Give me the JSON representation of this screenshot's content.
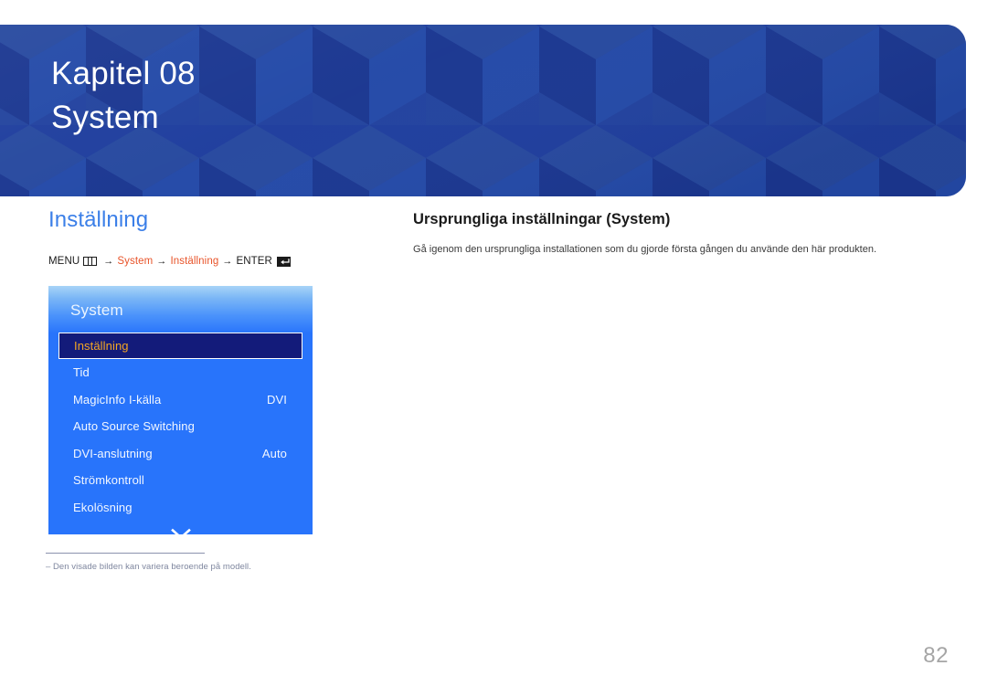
{
  "header": {
    "chapter_label": "Kapitel 08",
    "chapter_title": "System",
    "background_color": "#1f3e9e",
    "text_color": "#ffffff"
  },
  "left": {
    "section_heading": "Inställning",
    "section_heading_color": "#3b7fe8",
    "breadcrumb": {
      "menu_label": "MENU",
      "menu_icon": "menu-grid-icon",
      "arrow_1": "→",
      "crumb_1": "System",
      "arrow_2": "→",
      "crumb_2": "Inställning",
      "arrow_3": "→",
      "enter_label": "ENTER",
      "enter_icon": "enter-return-icon",
      "crumb_color": "#e8542a"
    },
    "osd": {
      "title": "System",
      "panel_color": "#2874fb",
      "selected_row_color": "#131b7a",
      "selected_text_color": "#f5a623",
      "items": [
        {
          "label": "Inställning",
          "value": "",
          "selected": true
        },
        {
          "label": "Tid",
          "value": "",
          "selected": false
        },
        {
          "label": "MagicInfo I-källa",
          "value": "DVI",
          "selected": false
        },
        {
          "label": "Auto Source Switching",
          "value": "",
          "selected": false
        },
        {
          "label": "DVI-anslutning",
          "value": "Auto",
          "selected": false
        },
        {
          "label": "Strömkontroll",
          "value": "",
          "selected": false
        },
        {
          "label": "Ekolösning",
          "value": "",
          "selected": false
        }
      ],
      "scroll_indicator": "chevron-down-icon"
    },
    "footnote": "‒ Den visade bilden kan variera beroende på modell."
  },
  "right": {
    "heading": "Ursprungliga inställningar (System)",
    "description": "Gå igenom den ursprungliga installationen som du gjorde första gången du använde den här produkten."
  },
  "page_number": "82"
}
